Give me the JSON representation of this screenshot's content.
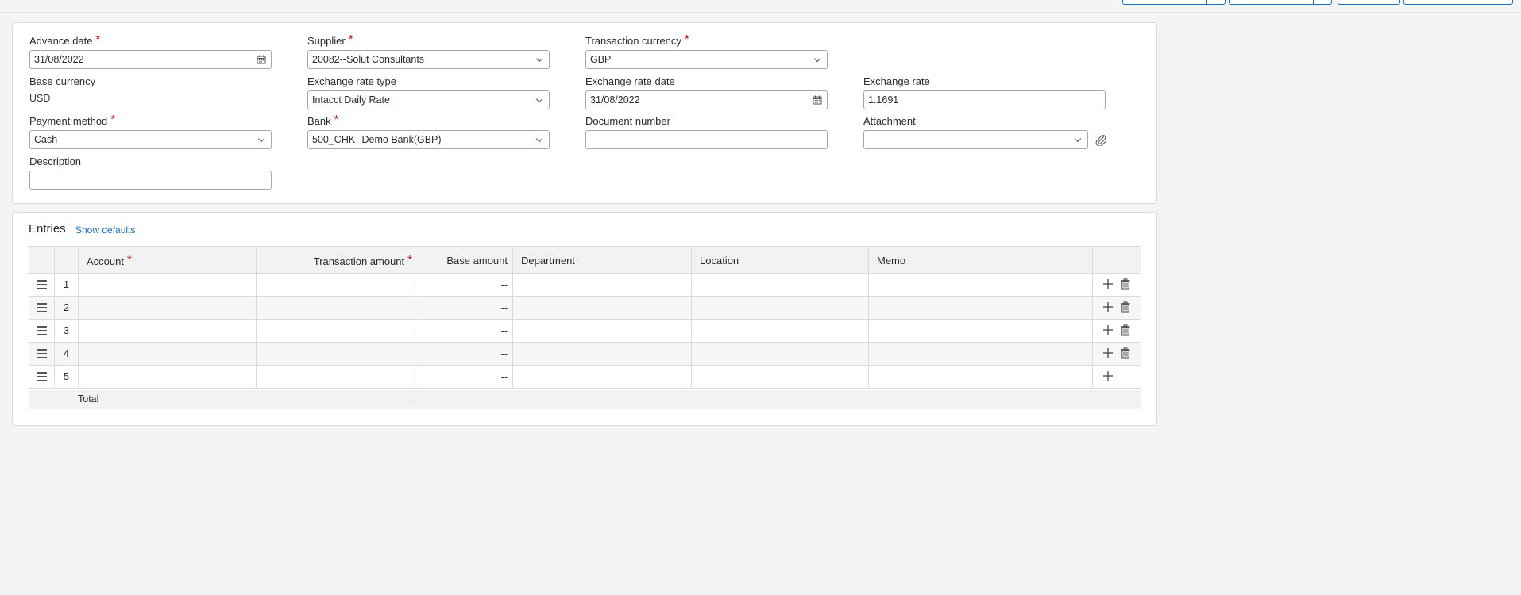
{
  "form": {
    "advance_date": {
      "label": "Advance date",
      "value": "31/08/2022"
    },
    "supplier": {
      "label": "Supplier",
      "value": "20082--Solut Consultants"
    },
    "transaction_currency": {
      "label": "Transaction currency",
      "value": "GBP"
    },
    "base_currency": {
      "label": "Base currency",
      "value": "USD"
    },
    "exchange_rate_type": {
      "label": "Exchange rate type",
      "value": "Intacct Daily Rate"
    },
    "exchange_rate_date": {
      "label": "Exchange rate date",
      "value": "31/08/2022"
    },
    "exchange_rate": {
      "label": "Exchange rate",
      "value": "1.1691"
    },
    "payment_method": {
      "label": "Payment method",
      "value": "Cash"
    },
    "bank": {
      "label": "Bank",
      "value": "500_CHK--Demo Bank(GBP)"
    },
    "document_number": {
      "label": "Document number",
      "value": ""
    },
    "attachment": {
      "label": "Attachment",
      "value": ""
    },
    "description": {
      "label": "Description",
      "value": ""
    },
    "required_mark": "*"
  },
  "entries": {
    "title": "Entries",
    "show_defaults": "Show defaults",
    "columns": {
      "account": "Account",
      "transaction_amount": "Transaction amount",
      "base_amount": "Base amount",
      "department": "Department",
      "location": "Location",
      "memo": "Memo"
    },
    "rows": [
      {
        "num": "1",
        "base_amount": "--"
      },
      {
        "num": "2",
        "base_amount": "--"
      },
      {
        "num": "3",
        "base_amount": "--"
      },
      {
        "num": "4",
        "base_amount": "--"
      },
      {
        "num": "5",
        "base_amount": "--"
      }
    ],
    "total": {
      "label": "Total",
      "transaction_amount": "--",
      "base_amount": "--"
    }
  },
  "colors": {
    "accent": "#1a6fb5",
    "required": "#c0151b",
    "border": "#d8dbde"
  }
}
